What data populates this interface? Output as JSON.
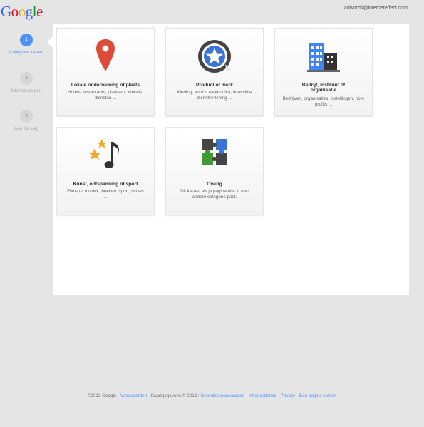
{
  "header": {
    "logo": [
      "G",
      "o",
      "o",
      "g",
      "l",
      "e"
    ],
    "logo_colors": [
      "#3369e8",
      "#d50f25",
      "#eeb211",
      "#3369e8",
      "#009925",
      "#d50f25"
    ],
    "account": "adwords@interneteffect.com"
  },
  "steps": [
    {
      "number": "1",
      "label": "Categorie kiezen",
      "state": "active"
    },
    {
      "number": "2",
      "label": "Info toevoegen",
      "state": "inactive"
    },
    {
      "number": "3",
      "label": "Aan de slag",
      "state": "inactive"
    }
  ],
  "categories": [
    {
      "title": "Lokale onderneming of plaats",
      "desc": "Hotels, restaurants, plaatsen, winkels, diensten ...",
      "icon": "map-pin-icon"
    },
    {
      "title": "Product of merk",
      "desc": "Kleding, auto's, elektronica, financiële dienstverlening ...",
      "icon": "star-badge-icon"
    },
    {
      "title": "Bedrijf, instituut of organisatie",
      "desc": "Bedrijven, organisaties, instellingen, non-profits ...",
      "icon": "buildings-icon"
    },
    {
      "title": "Kunst, ontspanning of sport",
      "desc": "Films,tv, muziek, boeken, sport, shows ...",
      "icon": "music-stars-icon"
    },
    {
      "title": "Overig",
      "desc": "Dit kiezen als je pagina niet in een andere categorie past.",
      "icon": "puzzle-icon"
    }
  ],
  "footer": {
    "copyright": "©2013 Google - ",
    "terms": "Voorwaarden",
    "map_data": " - Kaartgegevens © 2013 : ",
    "usage": "Gebruiksvoorwaarden",
    "sep1": " - ",
    "content_policy": "Inhoudsbeleid",
    "sep2": " - ",
    "privacy": "Privacy",
    "sep3": " - ",
    "create_page": "Een pagina maken"
  },
  "colors": {
    "accent": "#4d90fe",
    "pin_red": "#dd4b39",
    "building_blue": "#4285f4",
    "building_dark": "#333333",
    "star_gold": "#f4a82a",
    "puzzle_green": "#3f9c35",
    "puzzle_blue": "#3b74d6",
    "puzzle_dark": "#444444"
  }
}
